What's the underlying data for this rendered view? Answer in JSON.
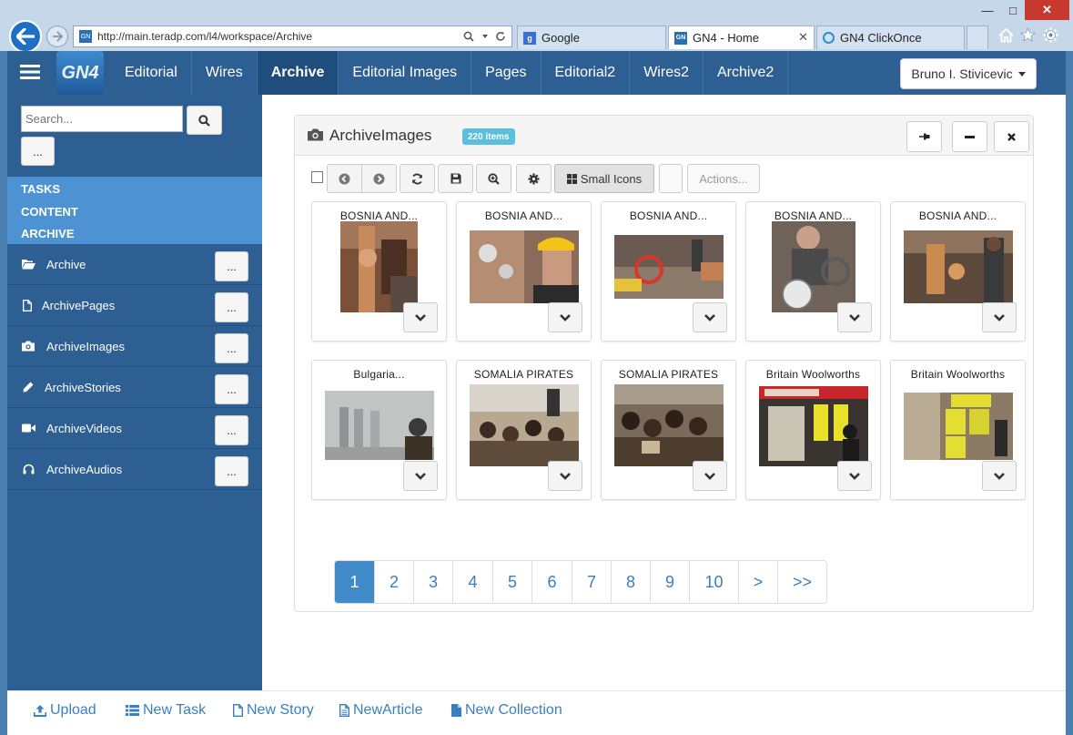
{
  "browser": {
    "address": "http://main.teradp.com/l4/workspace/Archive",
    "tabs": [
      {
        "label": "Google"
      },
      {
        "label": "GN4 - Home"
      },
      {
        "label": "GN4 ClickOnce"
      }
    ],
    "min_label": "—",
    "max_label": "□",
    "close_label": "✕"
  },
  "header": {
    "logo_text": "GN4",
    "nav": [
      "Editorial",
      "Wires",
      "Archive",
      "Editorial Images",
      "Pages",
      "Editorial2",
      "Wires2",
      "Archive2"
    ],
    "active_nav": "Archive",
    "user": "Bruno I. Stivicevic"
  },
  "sidebar": {
    "search_placeholder": "Search...",
    "more_label": "...",
    "sections": [
      "TASKS",
      "CONTENT",
      "ARCHIVE"
    ],
    "items": [
      {
        "label": "Archive",
        "icon": "folder-open-icon",
        "btn": "..."
      },
      {
        "label": "ArchivePages",
        "icon": "file-icon",
        "btn": "..."
      },
      {
        "label": "ArchiveImages",
        "icon": "camera-icon",
        "btn": "..."
      },
      {
        "label": "ArchiveStories",
        "icon": "pencil-icon",
        "btn": "..."
      },
      {
        "label": "ArchiveVideos",
        "icon": "video-camera-icon",
        "btn": "..."
      },
      {
        "label": "ArchiveAudios",
        "icon": "headphones-icon",
        "btn": "..."
      }
    ]
  },
  "panel": {
    "title": "ArchiveImages",
    "badge": "220 items",
    "toolbar": {
      "view_label": "Small Icons",
      "actions_label": "Actions..."
    },
    "cards": [
      {
        "title": "BOSNIA AND...",
        "image": "industrial-pipes-photo"
      },
      {
        "title": "BOSNIA AND...",
        "image": "worker-hardhat-photo"
      },
      {
        "title": "BOSNIA AND...",
        "image": "red-valve-photo"
      },
      {
        "title": "BOSNIA AND...",
        "image": "man-with-gauge-photo"
      },
      {
        "title": "BOSNIA AND...",
        "image": "copper-pipes-photo"
      },
      {
        "title": "Bulgaria...",
        "image": "power-plant-photo"
      },
      {
        "title": "SOMALIA PIRATES",
        "image": "crowd-boat-photo"
      },
      {
        "title": "SOMALIA PIRATES",
        "image": "crowd-dark-photo"
      },
      {
        "title": "Britain Woolworths",
        "image": "woolworths-storefront-photo"
      },
      {
        "title": "Britain Woolworths",
        "image": "store-closing-sign-photo"
      }
    ],
    "pages": [
      "1",
      "2",
      "3",
      "4",
      "5",
      "6",
      "7",
      "8",
      "9",
      "10",
      ">",
      ">>"
    ],
    "current_page": "1"
  },
  "footer": {
    "links": [
      {
        "label": "Upload",
        "icon": "upload-icon"
      },
      {
        "label": "New Task",
        "icon": "task-list-icon"
      },
      {
        "label": "New Story",
        "icon": "document-icon"
      },
      {
        "label": "NewArticle",
        "icon": "article-icon"
      },
      {
        "label": "New Collection",
        "icon": "collection-icon"
      }
    ]
  },
  "colors": {
    "header_bg": "#2d5f92",
    "accent": "#428bca",
    "section_bg": "#4d93d3",
    "badge": "#5bc0de"
  }
}
